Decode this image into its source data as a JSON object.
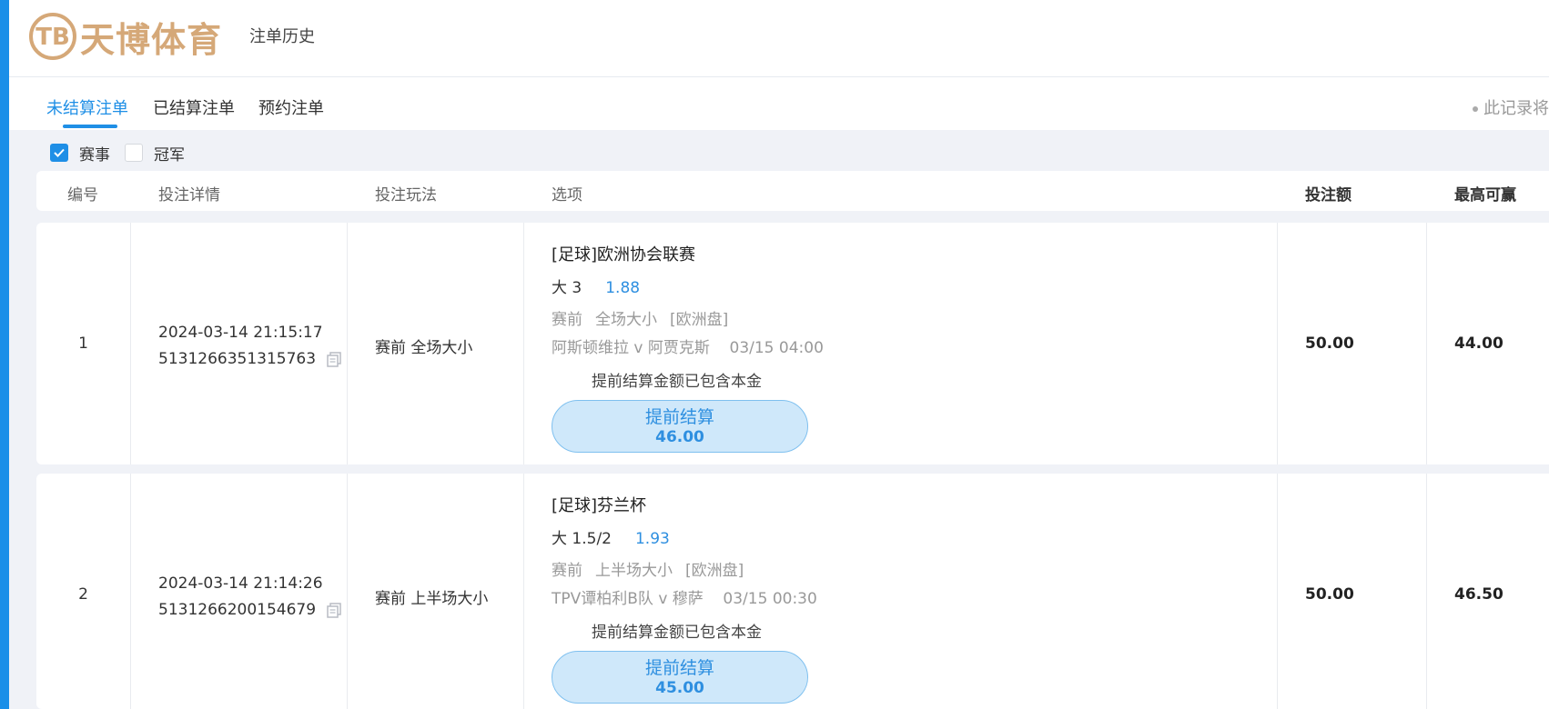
{
  "header": {
    "logo_text": "天博体育",
    "logo_mark": "TB",
    "title": "注单历史"
  },
  "tabs": [
    {
      "label": "未结算注单",
      "active": true
    },
    {
      "label": "已结算注单",
      "active": false
    },
    {
      "label": "预约注单",
      "active": false
    }
  ],
  "notice": "此记录将",
  "filters": [
    {
      "label": "赛事",
      "checked": true
    },
    {
      "label": "冠军",
      "checked": false
    }
  ],
  "columns": {
    "num": "编号",
    "detail": "投注详情",
    "method": "投注玩法",
    "option": "选项",
    "stake": "投注额",
    "max_win": "最高可赢"
  },
  "rows": [
    {
      "num": "1",
      "datetime": "2024-03-14 21:15:17",
      "order_id": "5131266351315763",
      "method": "赛前 全场大小",
      "league": "[足球]欧洲协会联赛",
      "pick": "大 3",
      "odds": "1.88",
      "meta_stage": "赛前",
      "meta_market": "全场大小",
      "meta_line": "[欧洲盘]",
      "match": "阿斯顿维拉 v 阿贾克斯",
      "match_time": "03/15 04:00",
      "note": "提前结算金额已包含本金",
      "cashout_label": "提前结算",
      "cashout_amount": "46.00",
      "stake": "50.00",
      "max_win": "44.00"
    },
    {
      "num": "2",
      "datetime": "2024-03-14 21:14:26",
      "order_id": "5131266200154679",
      "method": "赛前 上半场大小",
      "league": "[足球]芬兰杯",
      "pick": "大 1.5/2",
      "odds": "1.93",
      "meta_stage": "赛前",
      "meta_market": "上半场大小",
      "meta_line": "[欧洲盘]",
      "match": "TPV谭柏利B队 v 穆萨",
      "match_time": "03/15 00:30",
      "note": "提前结算金额已包含本金",
      "cashout_label": "提前结算",
      "cashout_amount": "45.00",
      "stake": "50.00",
      "max_win": "46.50"
    }
  ],
  "colors": {
    "accent": "#1f8fe6",
    "odds": "#2e8fe0",
    "logo": "#d5a878",
    "cashout_bg": "#cfe8fa"
  }
}
